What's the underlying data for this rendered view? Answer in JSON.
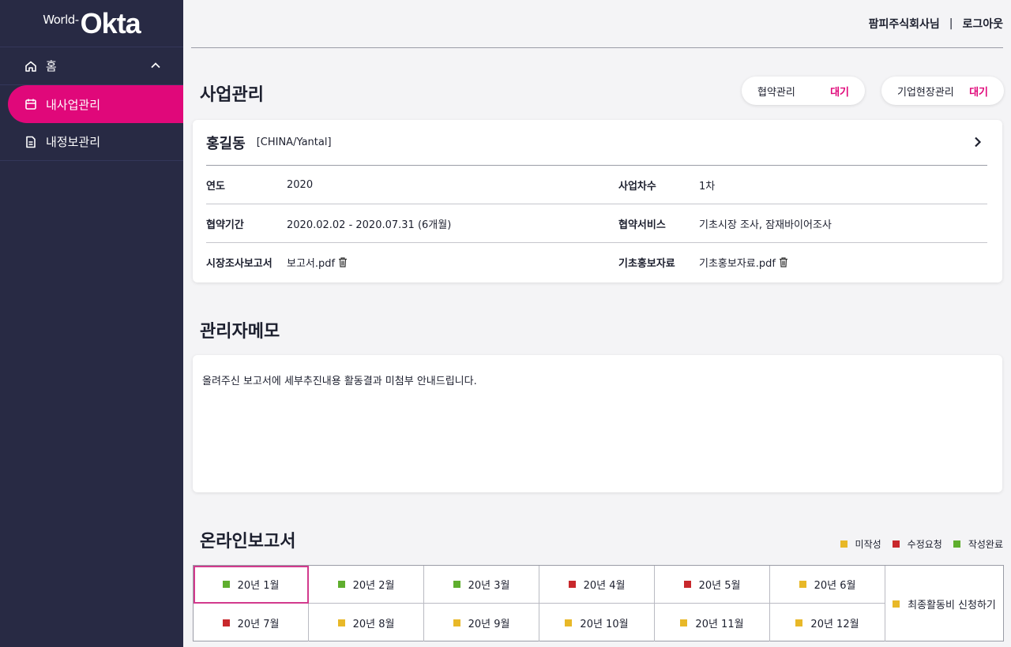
{
  "logo": {
    "prefix": "World-",
    "brand": "Okta"
  },
  "sidebar": {
    "items": [
      {
        "label": "홈",
        "icon": "home-icon",
        "expanded": true
      },
      {
        "label": "내사업관리",
        "icon": "calendar-icon",
        "active": true
      },
      {
        "label": "내정보관리",
        "icon": "document-icon"
      }
    ]
  },
  "header": {
    "user": "팜피주식회사님",
    "separator": "|",
    "logout": "로그아웃"
  },
  "business": {
    "title": "사업관리",
    "badges": [
      {
        "label": "협약관리",
        "status": "대기"
      },
      {
        "label": "기업현장관리",
        "status": "대기"
      }
    ],
    "name": "홍길동",
    "location": "[CHINA/Yantal]",
    "rows": [
      {
        "l1": "연도",
        "v1": "2020",
        "l2": "사업차수",
        "v2": "1차"
      },
      {
        "l1": "협약기간",
        "v1": "2020.02.02 - 2020.07.31 (6개월)",
        "l2": "협약서비스",
        "v2": "기초시장 조사, 잠재바이어조사"
      },
      {
        "l1": "시장조사보고서",
        "v1": "보고서.pdf",
        "l2": "기초홍보자료",
        "v2": "기초홍보자료.pdf"
      }
    ]
  },
  "memo": {
    "title": "관리자메모",
    "text": "올려주신 보고서에 세부추진내용 활동결과 미첨부 안내드립니다."
  },
  "reports": {
    "title": "온라인보고서",
    "legend": [
      {
        "label": "미작성",
        "color": "#e8b828"
      },
      {
        "label": "수정요청",
        "color": "#c8282c"
      },
      {
        "label": "작성완료",
        "color": "#5fae2e"
      }
    ],
    "months": [
      {
        "label": "20년 1월",
        "color": "#5fae2e",
        "selected": true
      },
      {
        "label": "20년 2월",
        "color": "#5fae2e"
      },
      {
        "label": "20년 3월",
        "color": "#5fae2e"
      },
      {
        "label": "20년 4월",
        "color": "#c8282c"
      },
      {
        "label": "20년 5월",
        "color": "#c8282c"
      },
      {
        "label": "20년 6월",
        "color": "#e8b828"
      },
      {
        "label": "20년 7월",
        "color": "#c8282c"
      },
      {
        "label": "20년 8월",
        "color": "#e8b828"
      },
      {
        "label": "20년 9월",
        "color": "#e8b828"
      },
      {
        "label": "20년 10월",
        "color": "#e8b828"
      },
      {
        "label": "20년 11월",
        "color": "#e8b828"
      },
      {
        "label": "20년 12월",
        "color": "#e8b828"
      }
    ],
    "final": {
      "label": "최종활동비 신청하기",
      "color": "#e8b828"
    }
  }
}
